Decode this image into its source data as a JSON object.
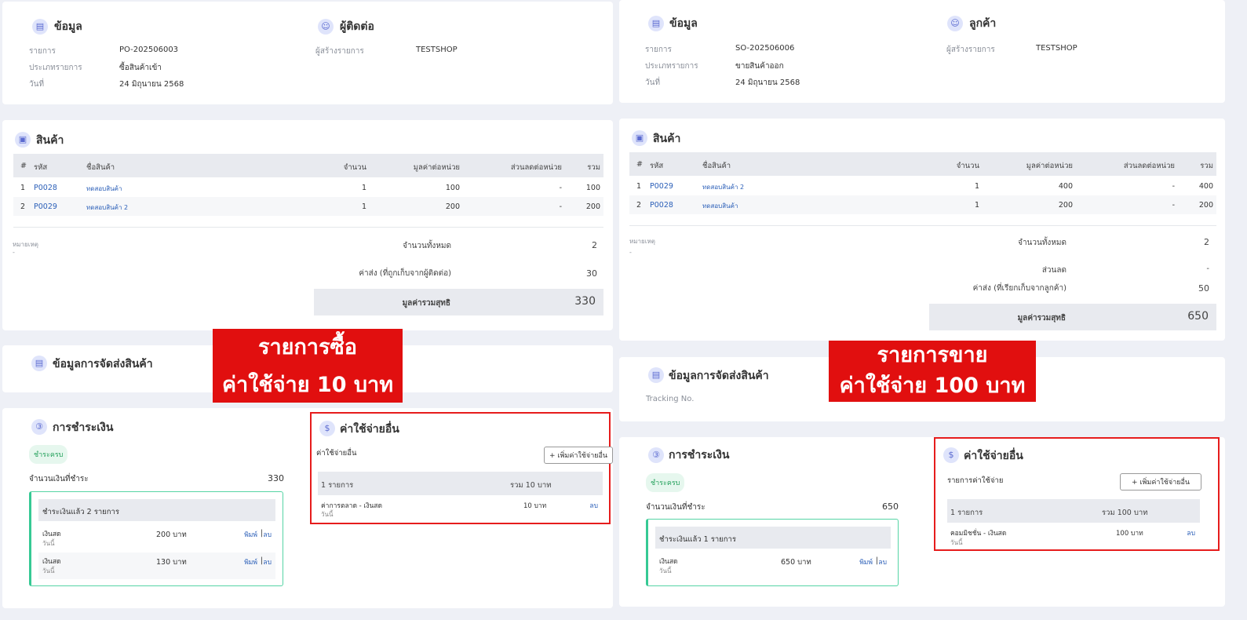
{
  "left": {
    "info": {
      "title": "ข้อมูล",
      "rows": [
        {
          "label": "รายการ",
          "value": "PO-202506003"
        },
        {
          "label": "ประเภทรายการ",
          "value": "ซื้อสินค้าเข้า"
        },
        {
          "label": "วันที่",
          "value": "24 มิถุนายน 2568"
        }
      ]
    },
    "party": {
      "title": "ผู้ติดต่อ",
      "label": "ผู้สร้างรายการ",
      "value": "TESTSHOP"
    },
    "products": {
      "title": "สินค้า",
      "headers": [
        "#",
        "รหัส",
        "ชื่อสินค้า",
        "จำนวน",
        "มูลค่าต่อหน่วย",
        "ส่วนลดต่อหน่วย",
        "รวม"
      ],
      "rows": [
        {
          "no": "1",
          "code": "P0028",
          "name": "ทดสอบสินค้า",
          "qty": "1",
          "price": "100",
          "discount": "-",
          "total": "100"
        },
        {
          "no": "2",
          "code": "P0029",
          "name": "ทดสอบสินค้า 2",
          "qty": "1",
          "price": "200",
          "discount": "-",
          "total": "200"
        }
      ],
      "note_label": "หมายเหตุ",
      "note_value": "-",
      "count_label": "จำนวนทั้งหมด",
      "count_value": "2",
      "shipping_label": "ค่าส่ง (ที่ถูกเก็บจากผู้ติดต่อ)",
      "shipping_value": "30",
      "net_label": "มูลค่ารวมสุทธิ",
      "net_value": "330"
    },
    "shipping": {
      "title": "ข้อมูลการจัดส่งสินค้า"
    },
    "payment": {
      "title": "การชำระเงิน",
      "badge": "ชำระครบ",
      "amount_label": "จำนวนเงินที่ชำระ",
      "amount_value": "330",
      "box_title": "ชำระเงินแล้ว 2 รายการ",
      "rows": [
        {
          "method": "เงินสด",
          "date": "วันนี้",
          "amount": "200 บาท",
          "print": "พิมพ์",
          "sep": "|",
          "delete": "ลบ"
        },
        {
          "method": "เงินสด",
          "date": "วันนี้",
          "amount": "130 บาท",
          "print": "พิมพ์",
          "sep": "|",
          "delete": "ลบ"
        }
      ]
    },
    "expenses": {
      "title": "ค่าใช้จ่ายอื่น",
      "subtitle": "ค่าใช้จ่ายอื่น",
      "add_button": "+ เพิ่มค่าใช้จ่ายอื่น",
      "count": "1 รายการ",
      "sum": "รวม 10 บาท",
      "item": {
        "name": "ค่าการตลาด - เงินสด",
        "date": "วันนี้",
        "amount": "10 บาท",
        "delete": "ลบ"
      }
    },
    "banner": {
      "line1": "รายการซื้อ",
      "line2": "ค่าใช้จ่าย 10 บาท"
    }
  },
  "right": {
    "info": {
      "title": "ข้อมูล",
      "rows": [
        {
          "label": "รายการ",
          "value": "SO-202506006"
        },
        {
          "label": "ประเภทรายการ",
          "value": "ขายสินค้าออก"
        },
        {
          "label": "วันที่",
          "value": "24 มิถุนายน 2568"
        }
      ]
    },
    "party": {
      "title": "ลูกค้า",
      "label": "ผู้สร้างรายการ",
      "value": "TESTSHOP"
    },
    "products": {
      "title": "สินค้า",
      "headers": [
        "#",
        "รหัส",
        "ชื่อสินค้า",
        "จำนวน",
        "มูลค่าต่อหน่วย",
        "ส่วนลดต่อหน่วย",
        "รวม"
      ],
      "rows": [
        {
          "no": "1",
          "code": "P0029",
          "name": "ทดสอบสินค้า 2",
          "qty": "1",
          "price": "400",
          "discount": "-",
          "total": "400"
        },
        {
          "no": "2",
          "code": "P0028",
          "name": "ทดสอบสินค้า",
          "qty": "1",
          "price": "200",
          "discount": "-",
          "total": "200"
        }
      ],
      "note_label": "หมายเหตุ",
      "note_value": "-",
      "count_label": "จำนวนทั้งหมด",
      "count_value": "2",
      "discount_label": "ส่วนลด",
      "discount_value": "-",
      "shipping_label": "ค่าส่ง (ที่เรียกเก็บจากลูกค้า)",
      "shipping_value": "50",
      "net_label": "มูลค่ารวมสุทธิ",
      "net_value": "650"
    },
    "shipping": {
      "title": "ข้อมูลการจัดส่งสินค้า",
      "tracking": "Tracking No."
    },
    "payment": {
      "title": "การชำระเงิน",
      "badge": "ชำระครบ",
      "amount_label": "จำนวนเงินที่ชำระ",
      "amount_value": "650",
      "box_title": "ชำระเงินแล้ว 1 รายการ",
      "rows": [
        {
          "method": "เงินสด",
          "date": "วันนี้",
          "amount": "650 บาท",
          "print": "พิมพ์",
          "sep": "|",
          "delete": "ลบ"
        }
      ]
    },
    "expenses": {
      "title": "ค่าใช้จ่ายอื่น",
      "subtitle": "รายการค่าใช้จ่าย",
      "add_button": "+ เพิ่มค่าใช้จ่ายอื่น",
      "count": "1 รายการ",
      "sum": "รวม 100 บาท",
      "item": {
        "name": "คอมมิชชั่น - เงินสด",
        "date": "วันนี้",
        "amount": "100 บาท",
        "delete": "ลบ"
      }
    },
    "banner": {
      "line1": "รายการขาย",
      "line2": "ค่าใช้จ่าย 100 บาท"
    }
  },
  "colors": {
    "accent": "#5b6ad0",
    "paid": "#22a05a",
    "highlight": "#e61c1c",
    "banner": "#e10f0f",
    "link": "#2b5fb8"
  },
  "icons": {
    "info": "clipboard-icon",
    "contact": "user-icon",
    "products": "box-icon",
    "shipping": "clipboard-icon",
    "payment": "coin-icon",
    "expenses": "money-hand-icon"
  }
}
